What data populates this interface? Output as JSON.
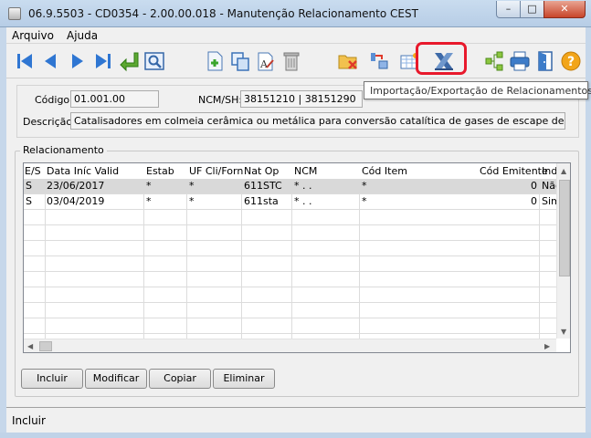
{
  "window": {
    "title": "06.9.5503 - CD0354 - 2.00.00.018 - Manutenção Relacionamento CEST",
    "min": "–",
    "max": "□",
    "close": "✕"
  },
  "menu": {
    "items": [
      "Arquivo",
      "Ajuda"
    ]
  },
  "toolbar": {
    "highlight_color": "#e8192c",
    "tooltip": "Importação/Exportação de Relacionamentos"
  },
  "form": {
    "codigo_label": "Código:",
    "codigo_value": "01.001.00",
    "ncm_label": "NCM/SH:",
    "ncm_value": "38151210 | 38151290",
    "descricao_label": "Descrição:",
    "descricao_value": "Catalisadores em colmeia cerâmica ou metálica para conversão catalítica de gases de escape de veículos e outros"
  },
  "relacionamento": {
    "title": "Relacionamento",
    "columns": [
      "E/S",
      "Data Iníc Valid",
      "Estab",
      "UF Cli/Forn",
      "Nat Op",
      "NCM",
      "Cód Item",
      "Cód Emitente",
      "Ind"
    ],
    "rows": [
      [
        "S",
        "23/06/2017",
        "*",
        "*",
        "611STC",
        "*  .  .",
        "*",
        "0",
        "Não"
      ],
      [
        "S",
        "03/04/2019",
        "*",
        "*",
        "611sta",
        "*  .  .",
        "*",
        "0",
        "Sim"
      ]
    ]
  },
  "buttons": {
    "incluir": "Incluir",
    "modificar": "Modificar",
    "copiar": "Copiar",
    "eliminar": "Eliminar"
  },
  "status": {
    "text": "Incluir"
  }
}
